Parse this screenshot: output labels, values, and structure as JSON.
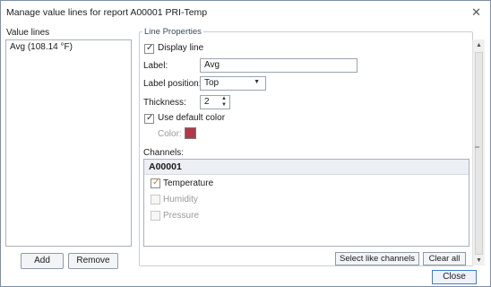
{
  "window": {
    "title": "Manage value lines for report A00001 PRI-Temp",
    "close_glyph": "✕"
  },
  "left": {
    "label": "Value lines",
    "items": [
      "Avg (108.14 °F)"
    ],
    "add_label": "Add",
    "remove_label": "Remove"
  },
  "properties": {
    "group_title": "Line Properties",
    "display_line_label": "Display line",
    "display_line_checked": true,
    "label_label": "Label:",
    "label_value": "Avg",
    "label_position_label": "Label position:",
    "label_position_value": "Top",
    "thickness_label": "Thickness:",
    "thickness_value": "2",
    "use_default_color_label": "Use default color",
    "use_default_color_checked": true,
    "color_label": "Color:",
    "color_value": "#b03848",
    "channels_label": "Channels:",
    "channel_group": "A00001",
    "channels": [
      {
        "label": "Temperature",
        "checked": true,
        "enabled": true
      },
      {
        "label": "Humidity",
        "checked": false,
        "enabled": false
      },
      {
        "label": "Pressure",
        "checked": false,
        "enabled": false
      }
    ],
    "select_like_label": "Select like channels",
    "clear_all_label": "Clear all"
  },
  "footer": {
    "close_label": "Close"
  }
}
